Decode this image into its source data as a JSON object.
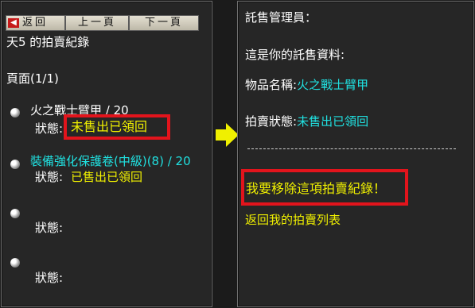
{
  "toolbar": {
    "back_label": "返回",
    "prev_label": "上一頁",
    "next_label": "下一頁"
  },
  "left": {
    "title": "天5 的拍賣紀錄",
    "page_label": "頁面(1/1)",
    "items": [
      {
        "name": "火之戰士臂甲 / 20",
        "status_label": "狀態:",
        "status_value": "未售出已領回"
      },
      {
        "name": "裝備強化保護卷(中級)(8) / 20",
        "status_label": "狀態:",
        "status_value": "已售出已領回"
      },
      {
        "name": "",
        "status_label": "狀態:",
        "status_value": ""
      },
      {
        "name": "",
        "status_label": "狀態:",
        "status_value": ""
      }
    ]
  },
  "right": {
    "heading": "託售管理員：",
    "intro": "這是你的託售資料:",
    "item_label": "物品名稱:",
    "item_value": "火之戰士臂甲",
    "status_label": "拍賣狀態:",
    "status_value": "未售出已領回",
    "divider": "--------------------------------------------",
    "remove_link": "我要移除這項拍賣紀錄！",
    "return_link": "返回我的拍賣列表"
  },
  "colors": {
    "text": "#ffffff",
    "cyan": "#20e0e0",
    "yellow": "#f0f000",
    "highlight": "#e2141c",
    "arrow": "#f0f000"
  },
  "icons": [
    "arrow-left-icon",
    "bullet-icon",
    "arrow-right-icon"
  ]
}
